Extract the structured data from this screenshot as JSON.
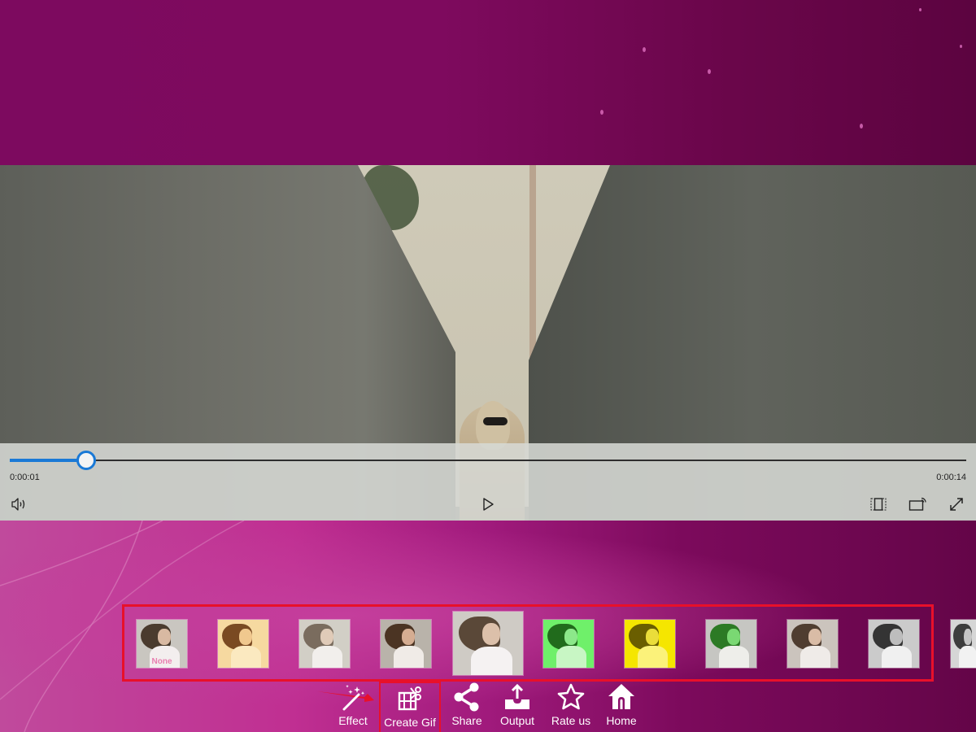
{
  "colors": {
    "accent": "#1a79d6",
    "highlight_border": "#e8102a",
    "background_top": "#7d0a5f",
    "background_bottom": "#c02f92"
  },
  "player": {
    "current_time": "0:00:01",
    "total_time": "0:00:14",
    "progress_fraction": 0.08,
    "buttons": {
      "volume": "volume-icon",
      "play": "play-icon",
      "aspect_ratio": "aspect-ratio-icon",
      "cast": "cast-icon",
      "fullscreen": "fullscreen-icon"
    }
  },
  "effects": {
    "selected_index": 4,
    "items": [
      {
        "label": "None",
        "filter": "normal"
      },
      {
        "label": "",
        "filter": "warm"
      },
      {
        "label": "",
        "filter": "faded"
      },
      {
        "label": "",
        "filter": "vignette"
      },
      {
        "label": "",
        "filter": "original-large"
      },
      {
        "label": "",
        "filter": "green"
      },
      {
        "label": "",
        "filter": "yellow"
      },
      {
        "label": "",
        "filter": "green-tint"
      },
      {
        "label": "",
        "filter": "sepia-light"
      },
      {
        "label": "",
        "filter": "grayscale"
      },
      {
        "label": "",
        "filter": "grayscale-partial"
      }
    ]
  },
  "toolbar": {
    "items": [
      {
        "label": "Effect",
        "icon": "magic-wand-icon"
      },
      {
        "label": "Create Gif",
        "icon": "film-scissors-icon"
      },
      {
        "label": "Share",
        "icon": "share-icon"
      },
      {
        "label": "Output",
        "icon": "upload-icon"
      },
      {
        "label": "Rate us",
        "icon": "star-icon"
      },
      {
        "label": "Home",
        "icon": "home-icon"
      }
    ],
    "highlighted": "Create Gif"
  }
}
